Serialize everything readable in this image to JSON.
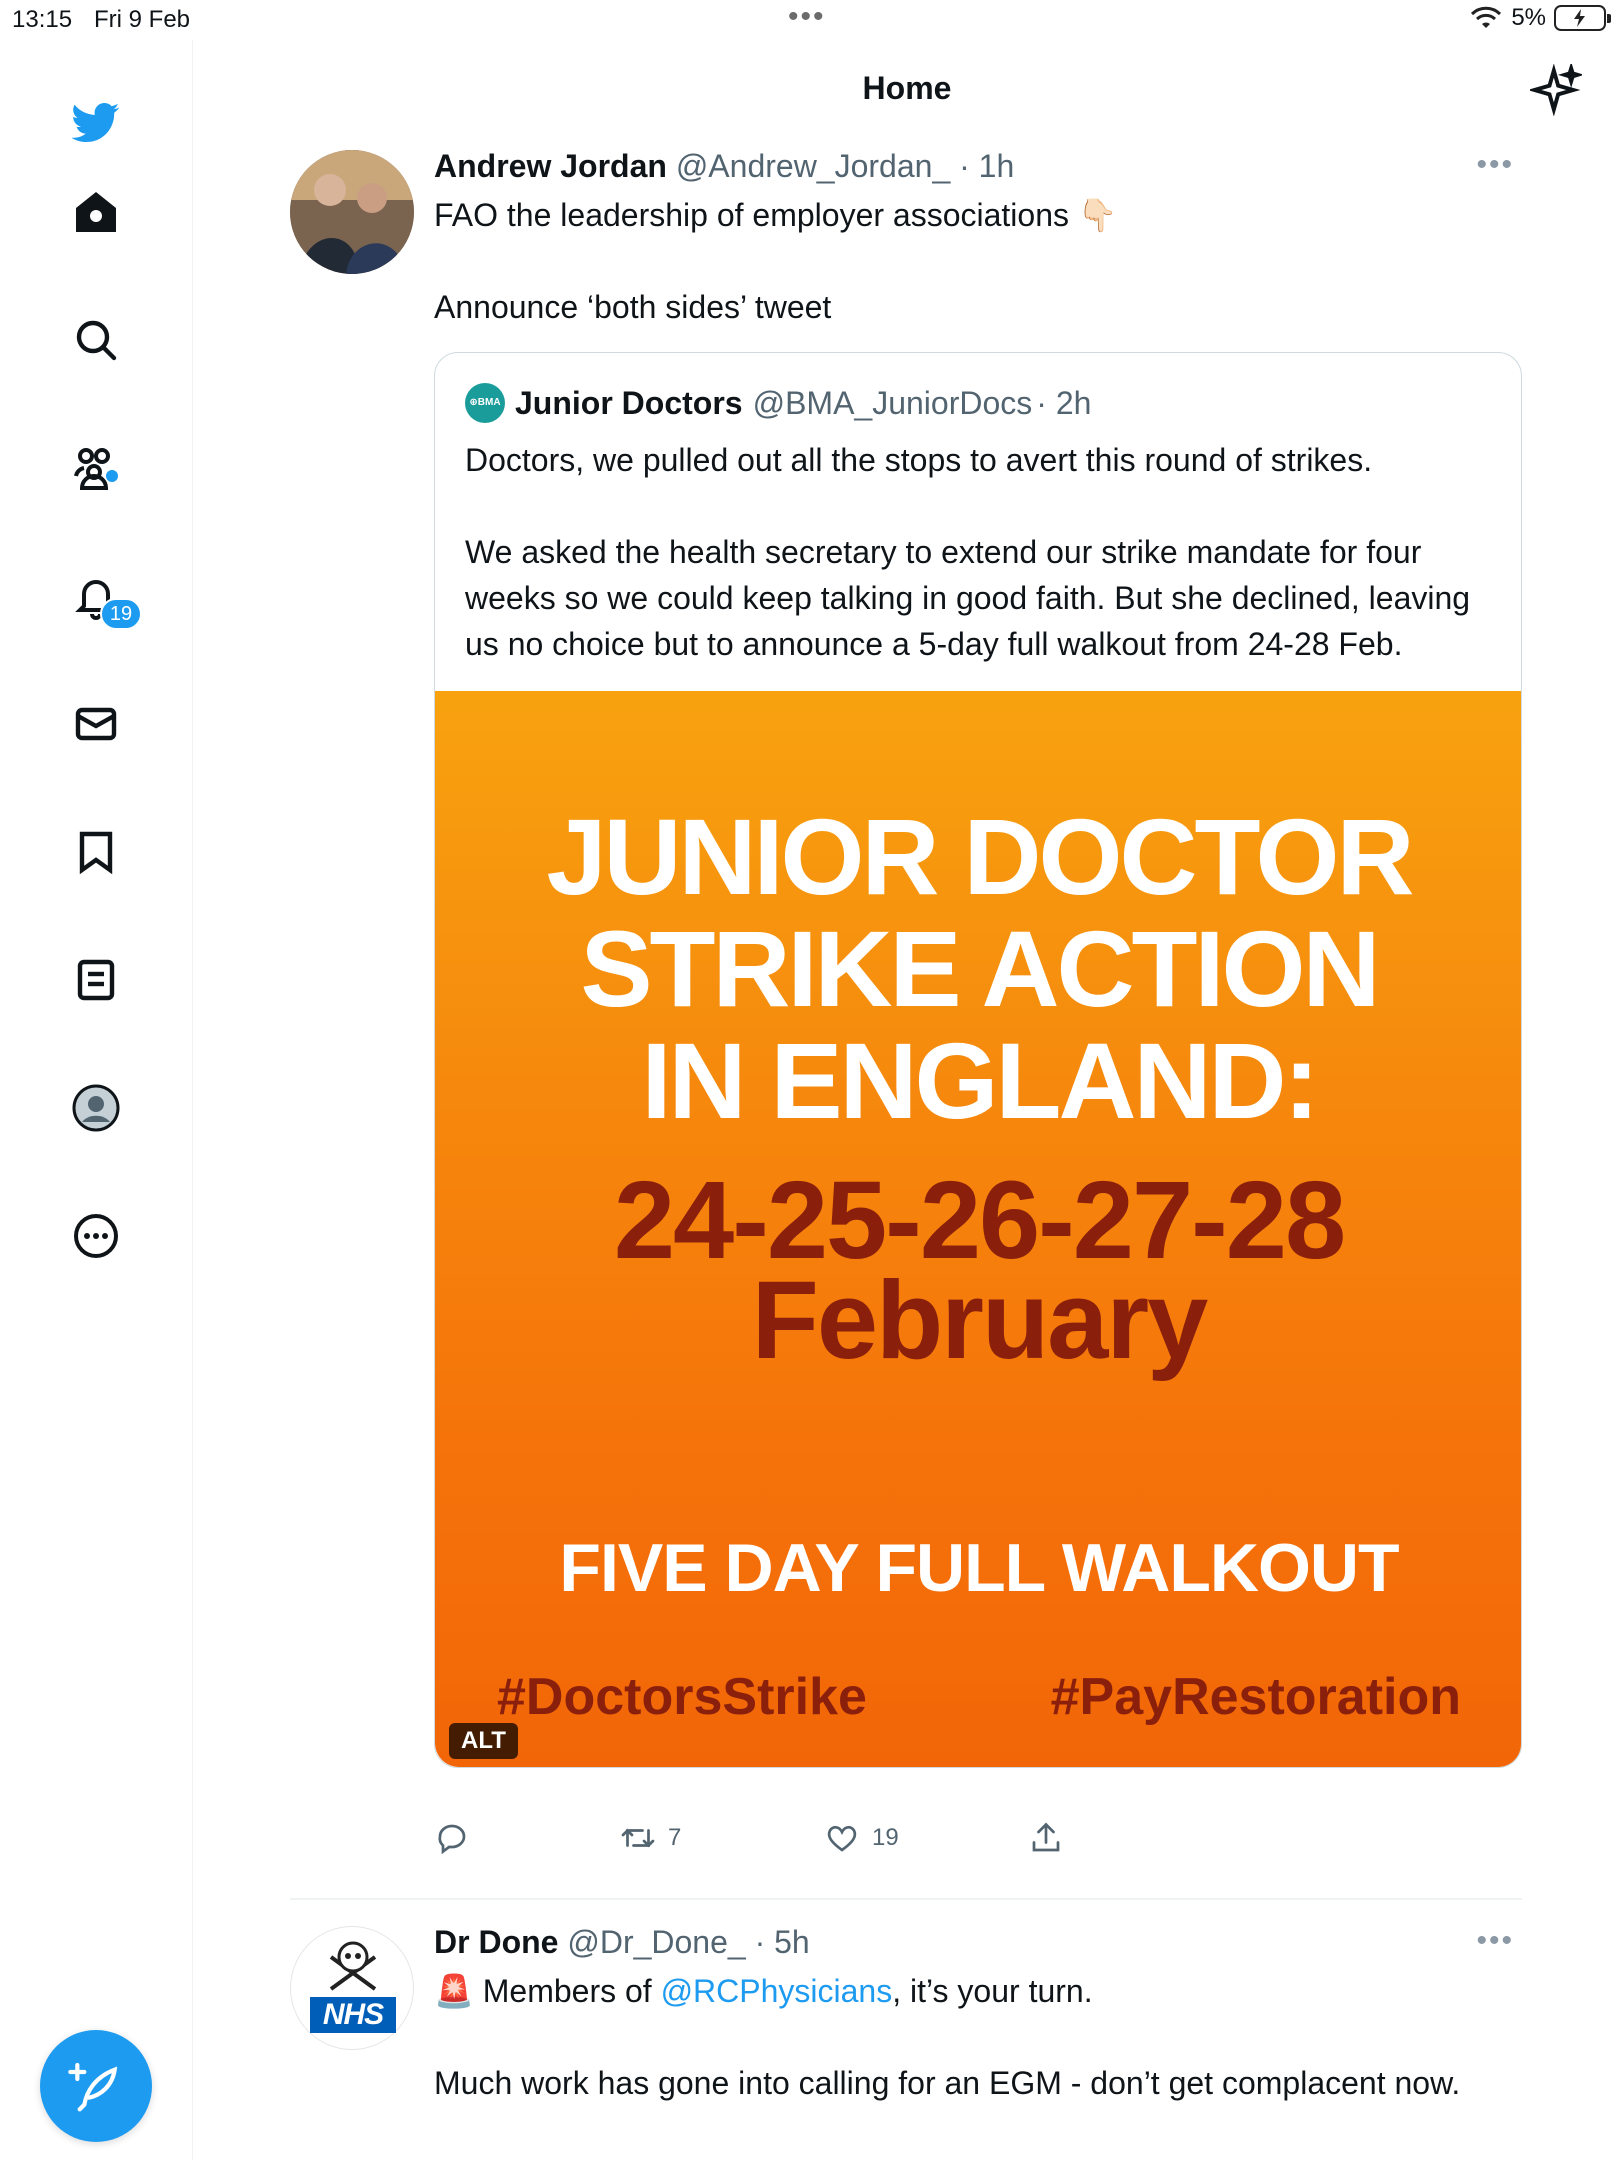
{
  "status_bar": {
    "time": "13:15",
    "date": "Fri 9 Feb",
    "battery": "5%"
  },
  "header": {
    "title": "Home"
  },
  "sidebar": {
    "notifications_badge": "19",
    "items": [
      "twitter-logo",
      "home",
      "explore",
      "communities",
      "notifications",
      "messages",
      "bookmarks",
      "lists",
      "profile",
      "more"
    ]
  },
  "tweets": [
    {
      "name": "Andrew Jordan",
      "handle": "@Andrew_Jordan_",
      "time": "· 1h",
      "text_line1": "FAO the leadership of employer associations",
      "emoji": "👇🏻",
      "text_line2": "Announce ‘both sides’ tweet",
      "quote": {
        "name": "Junior Doctors",
        "handle": "@BMA_JuniorDocs",
        "time": "· 2h",
        "logo_text": "⊕BMA",
        "para1": "Doctors, we pulled out all the stops to avert this round of strikes.",
        "para2": "We asked the health secretary to extend our strike mandate for four weeks so we could keep talking in good faith. But she declined, leaving us no choice but to announce a 5-day full walkout from 24-28 Feb.",
        "image": {
          "title_line1": "JUNIOR DOCTOR",
          "title_line2": "STRIKE ACTION",
          "title_line3": "IN ENGLAND:",
          "dates": "24-25-26-27-28",
          "month": "February",
          "walkout": "FIVE DAY FULL WALKOUT",
          "tag1": "#DoctorsStrike",
          "tag2": "#PayRestoration",
          "alt": "ALT"
        }
      },
      "actions": {
        "reply": "",
        "retweets": "7",
        "likes": "19"
      }
    },
    {
      "name": "Dr Done",
      "handle": "@Dr_Done_",
      "time": "· 5h",
      "emoji": "🚨",
      "text_pre": "Members of ",
      "mention": "@RCPhysicians",
      "text_post": ", it’s your turn.",
      "para2": "Much work has gone into calling for an EGM - don’t get complacent now.",
      "avatar_text": "NHS"
    }
  ],
  "colors": {
    "accent": "#1d9bf0",
    "image_orange": "#f5730a",
    "image_dark_red": "#8a1f0c"
  }
}
